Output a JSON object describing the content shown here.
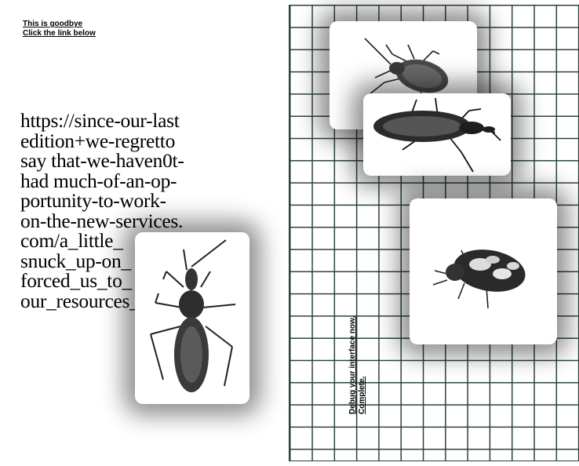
{
  "intro": {
    "line1": "This is goodbye",
    "line2": "Click the link below"
  },
  "url_text": {
    "lines": [
      "https://since-our-last",
      "edition+we-regretto",
      "say that-we-haven0t-",
      "had much-of-an-op-",
      "portunity-to-work-",
      "on-the-new-services.",
      "com/a_little_",
      "snuck_up-on_",
      "forced_us_to_",
      "our_resources_"
    ]
  },
  "vertical_text": {
    "line1": "Debug your interface now.",
    "line2": "Complete."
  },
  "images": {
    "stink_bug": "stink-bug-photo",
    "assassin_bug_top": "assassin-bug-photo",
    "carpet_beetle": "carpet-beetle-photo",
    "assassin_bug_left": "assassin-bug-photo"
  },
  "colors": {
    "grid_line": "#29423c",
    "text": "#000000",
    "background": "#ffffff"
  }
}
